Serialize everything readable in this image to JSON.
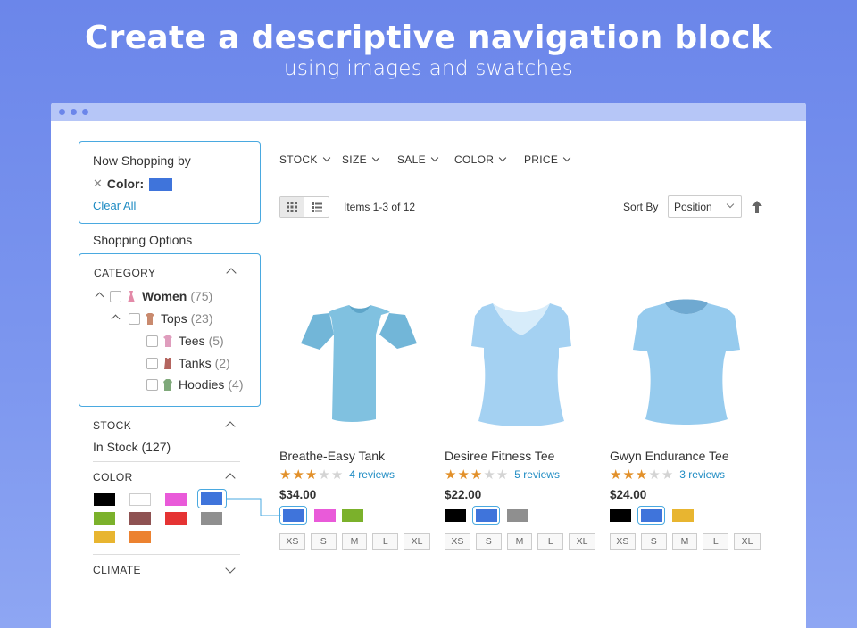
{
  "hero": {
    "title": "Create a descriptive navigation block",
    "subtitle": "using images and swatches"
  },
  "now_shopping": {
    "title": "Now Shopping by",
    "filter_label": "Color:",
    "filter_color": "#3f74db",
    "clear_all": "Clear All"
  },
  "shopping_options": "Shopping Options",
  "category": {
    "title": "CATEGORY",
    "tree": [
      {
        "name": "Women",
        "count": "(75)"
      },
      {
        "name": "Tops",
        "count": "(23)"
      },
      {
        "name": "Tees",
        "count": "(5)"
      },
      {
        "name": "Tanks",
        "count": "(2)"
      },
      {
        "name": "Hoodies",
        "count": "(4)"
      }
    ]
  },
  "stock": {
    "title": "STOCK",
    "value": "In Stock (127)"
  },
  "color": {
    "title": "COLOR",
    "swatches": [
      "#000000",
      "#ffffff",
      "#e95ad9",
      "#3f74db",
      "#7bb12b",
      "#8e5252",
      "#e53333",
      "#8f8f8f",
      "#e8b530",
      "#ec8230"
    ],
    "selected": "#3f74db"
  },
  "climate": {
    "title": "CLIMATE"
  },
  "filters": [
    "STOCK",
    "SIZE",
    "SALE",
    "COLOR",
    "PRICE"
  ],
  "toolbar": {
    "items": "Items 1-3 of 12",
    "sort_by": "Sort By",
    "sort_value": "Position"
  },
  "products": [
    {
      "name": "Breathe-Easy Tank",
      "rating": 3,
      "reviews": "4 reviews",
      "price": "$34.00",
      "colors": [
        "#3f74db",
        "#e95ad9",
        "#7bb12b"
      ],
      "selected": 0,
      "shirt": "#86c3e2"
    },
    {
      "name": "Desiree Fitness Tee",
      "rating": 3,
      "reviews": "5 reviews",
      "price": "$22.00",
      "colors": [
        "#000000",
        "#3f74db",
        "#8f8f8f"
      ],
      "selected": 1,
      "shirt": "#a6d2f3"
    },
    {
      "name": "Gwyn Endurance Tee",
      "rating": 3,
      "reviews": "3 reviews",
      "price": "$24.00",
      "colors": [
        "#000000",
        "#3f74db",
        "#e8b530"
      ],
      "selected": 1,
      "shirt": "#98cdf0"
    }
  ],
  "sizes": [
    "XS",
    "S",
    "M",
    "L",
    "XL"
  ]
}
